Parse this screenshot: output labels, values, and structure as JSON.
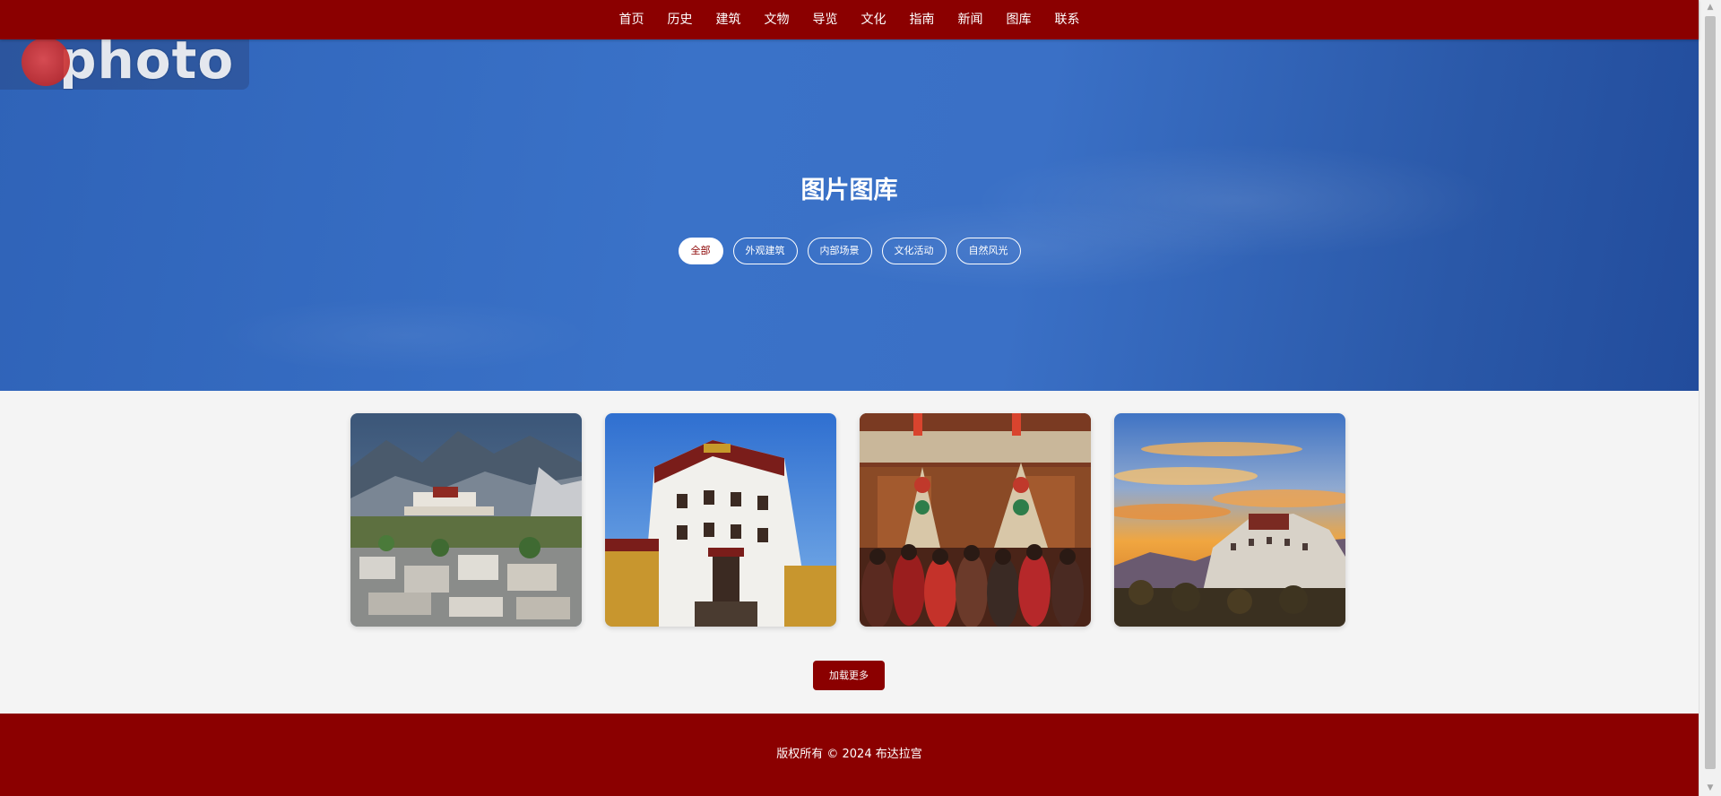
{
  "nav": {
    "items": [
      {
        "label": "首页"
      },
      {
        "label": "历史"
      },
      {
        "label": "建筑"
      },
      {
        "label": "文物"
      },
      {
        "label": "导览"
      },
      {
        "label": "文化"
      },
      {
        "label": "指南"
      },
      {
        "label": "新闻"
      },
      {
        "label": "图库"
      },
      {
        "label": "联系"
      }
    ]
  },
  "hero": {
    "watermark_text": "photo",
    "title": "图片图库",
    "filters": [
      {
        "label": "全部",
        "active": true
      },
      {
        "label": "外观建筑",
        "active": false
      },
      {
        "label": "内部场景",
        "active": false
      },
      {
        "label": "文化活动",
        "active": false
      },
      {
        "label": "自然风光",
        "active": false
      }
    ]
  },
  "gallery": {
    "items": [
      {
        "subject": "palace-with-city-view"
      },
      {
        "subject": "white-palace-facade"
      },
      {
        "subject": "interior-ceremony"
      },
      {
        "subject": "palace-at-sunset"
      }
    ]
  },
  "load_more_label": "加载更多",
  "footer": {
    "copyright": "版权所有 © 2024 布达拉宫"
  },
  "colors": {
    "primary": "#8b0000",
    "hero_blue": "#3a72c8",
    "page_bg": "#f4f4f4"
  }
}
